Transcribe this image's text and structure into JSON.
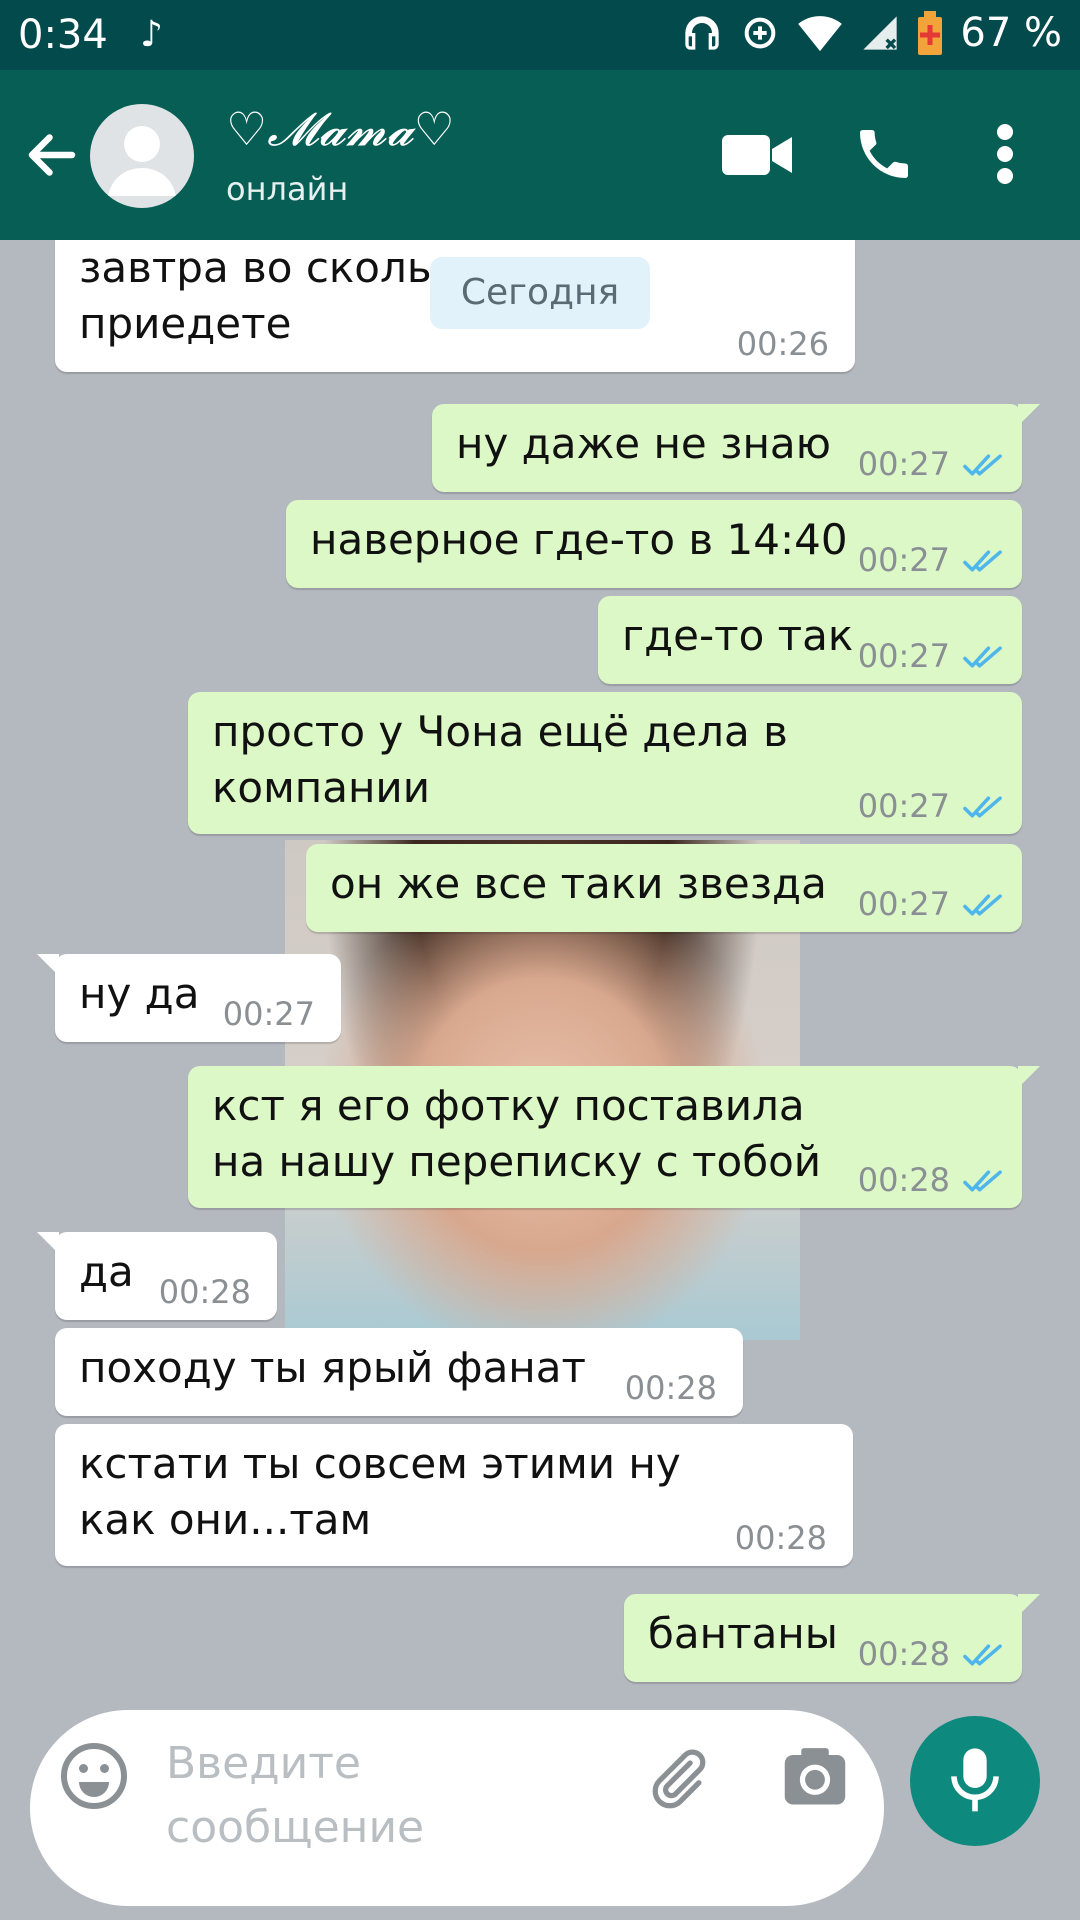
{
  "status_bar": {
    "time": "0:34",
    "battery": "67 %",
    "icons": [
      "music-note-icon",
      "headphones-icon",
      "data-saver-icon",
      "wifi-icon",
      "cell-signal-icon",
      "battery-charging-icon"
    ]
  },
  "header": {
    "contact_name": "♡𝓜𝓪𝓶𝓪♡",
    "status": "онлайн",
    "icons": [
      "back-arrow-icon",
      "avatar",
      "video-call-icon",
      "phone-icon",
      "more-vert-icon"
    ]
  },
  "chat": {
    "date_chip": "Сегодня",
    "messages": [
      {
        "dir": "in",
        "text": "завтра во скольк приедете",
        "time": "00:26"
      },
      {
        "dir": "out",
        "text": "ну даже не знаю",
        "time": "00:27",
        "read": true
      },
      {
        "dir": "out",
        "text": "наверное где-то в 14:40",
        "time": "00:27",
        "read": true
      },
      {
        "dir": "out",
        "text": "где-то так",
        "time": "00:27",
        "read": true
      },
      {
        "dir": "out",
        "text": "просто у Чона ещё дела в компании",
        "time": "00:27",
        "read": true
      },
      {
        "dir": "out",
        "text": "он же все таки звезда",
        "time": "00:27",
        "read": true
      },
      {
        "dir": "in",
        "text": "ну да",
        "time": "00:27"
      },
      {
        "dir": "out",
        "text": "кст я его фотку поставила на нашу переписку с тобой",
        "time": "00:28",
        "read": true
      },
      {
        "dir": "in",
        "text": "да",
        "time": "00:28"
      },
      {
        "dir": "in",
        "text": "походу ты ярый фанат",
        "time": "00:28"
      },
      {
        "dir": "in",
        "text": "кстати ты совсем этими ну как они...там",
        "time": "00:28"
      },
      {
        "dir": "out",
        "text": "бантаны",
        "time": "00:28",
        "read": true
      }
    ]
  },
  "input": {
    "placeholder": "Введите сообщение",
    "icons": [
      "emoji-icon",
      "attach-icon",
      "camera-icon",
      "mic-icon"
    ]
  },
  "colors": {
    "header": "#075e54",
    "status_bar": "#034a4d",
    "outgoing_bubble": "#dcf8c6",
    "incoming_bubble": "#ffffff",
    "read_ticks": "#4fb6ec",
    "mic_button": "#0d8a7d"
  }
}
